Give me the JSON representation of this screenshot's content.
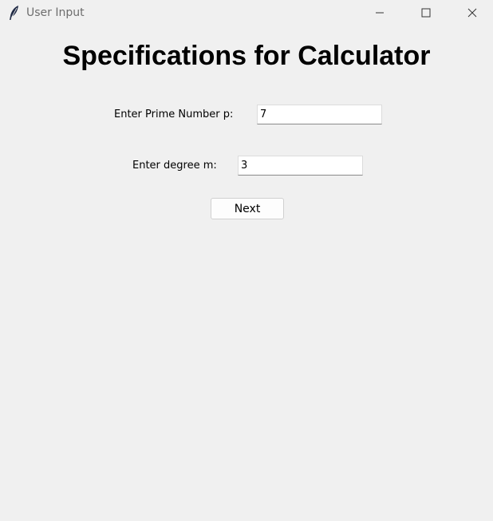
{
  "window": {
    "title": "User Input",
    "icon": "feather-icon",
    "controls": {
      "minimize_icon": "minimize-icon",
      "maximize_icon": "maximize-icon",
      "close_icon": "close-icon"
    }
  },
  "main": {
    "heading": "Specifications for Calculator",
    "fields": {
      "prime": {
        "label": "Enter Prime Number p:",
        "value": "7"
      },
      "degree": {
        "label": "Enter degree m:",
        "value": "3"
      }
    },
    "next_label": "Next"
  },
  "colors": {
    "background": "#f0f0f0",
    "title_text": "#6d6d6d",
    "entry_background": "#ffffff"
  }
}
